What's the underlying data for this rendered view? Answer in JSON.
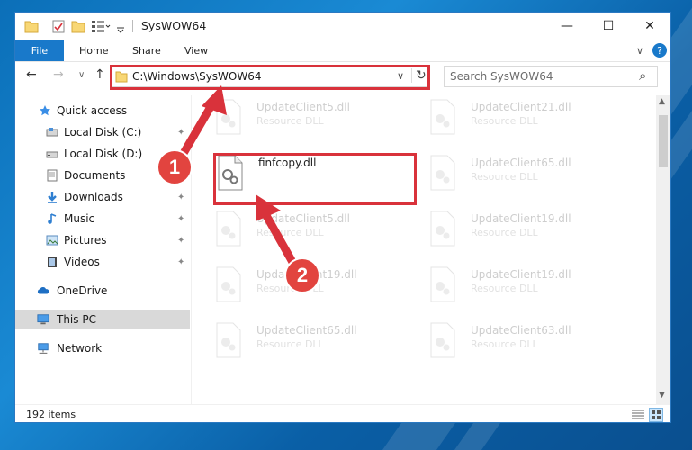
{
  "window": {
    "title": "SysWOW64",
    "minimize_glyph": "—",
    "maximize_glyph": "☐",
    "close_glyph": "✕"
  },
  "ribbon": {
    "file": "File",
    "tabs": [
      "Home",
      "Share",
      "View"
    ],
    "expand_glyph": "∨",
    "help_glyph": "?"
  },
  "nav": {
    "back": "←",
    "forward": "→",
    "recent": "∨",
    "up": "↑",
    "address": "C:\\Windows\\SysWOW64",
    "dropdown": "∨",
    "refresh": "↻",
    "search_placeholder": "Search SysWOW64",
    "search_glyph": "⌕"
  },
  "sidebar": {
    "quick_access": "Quick access",
    "items": [
      {
        "label": "Local Disk (C:)",
        "pinned": true
      },
      {
        "label": "Local Disk (D:)",
        "pinned": true
      },
      {
        "label": "Documents",
        "pinned": true
      },
      {
        "label": "Downloads",
        "pinned": true
      },
      {
        "label": "Music",
        "pinned": true
      },
      {
        "label": "Pictures",
        "pinned": true
      },
      {
        "label": "Videos",
        "pinned": true
      }
    ],
    "onedrive": "OneDrive",
    "this_pc": "This PC",
    "network": "Network",
    "pin_glyph": "📌"
  },
  "files": [
    {
      "name": "UpdateClient5.dll",
      "type": "Resource DLL",
      "faded": true
    },
    {
      "name": "UpdateClient21.dll",
      "type": "Resource DLL",
      "faded": true
    },
    {
      "name": "finfcopy.dll",
      "type": "",
      "faded": false
    },
    {
      "name": "UpdateClient65.dll",
      "type": "Resource DLL",
      "faded": true
    },
    {
      "name": "UpdateClient5.dll",
      "type": "Resource DLL",
      "faded": true
    },
    {
      "name": "UpdateClient19.dll",
      "type": "Resource DLL",
      "faded": true
    },
    {
      "name": "UpdateClient19.dll",
      "type": "Resource DLL",
      "faded": true
    },
    {
      "name": "UpdateClient19.dll",
      "type": "Resource DLL",
      "faded": true
    },
    {
      "name": "UpdateClient65.dll",
      "type": "Resource DLL",
      "faded": true
    },
    {
      "name": "UpdateClient63.dll",
      "type": "Resource DLL",
      "faded": true
    }
  ],
  "status": {
    "count": "192 items"
  },
  "annotations": {
    "step1": "1",
    "step2": "2"
  },
  "colors": {
    "accent": "#1979ca",
    "annotation_red": "#d9323b",
    "selection": "#cce8ff",
    "folder_yellow": "#f8d775"
  }
}
